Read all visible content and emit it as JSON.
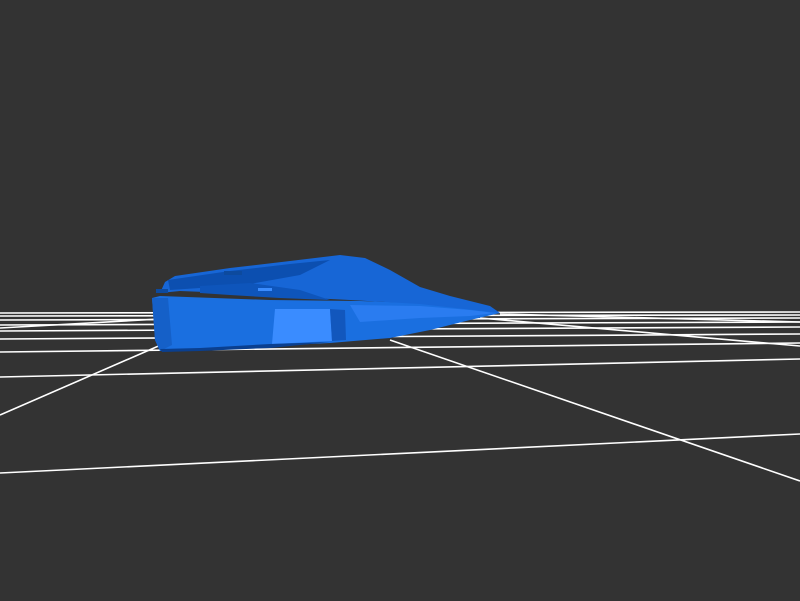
{
  "viewport": {
    "background_color": "#333333",
    "grid_color": "#ffffff",
    "model_color": "#1a6fe0",
    "model_shadow_color": "#0c4fb0",
    "model_highlight_color": "#3a8cff",
    "model_description": "car-body",
    "grid_visible": true
  }
}
